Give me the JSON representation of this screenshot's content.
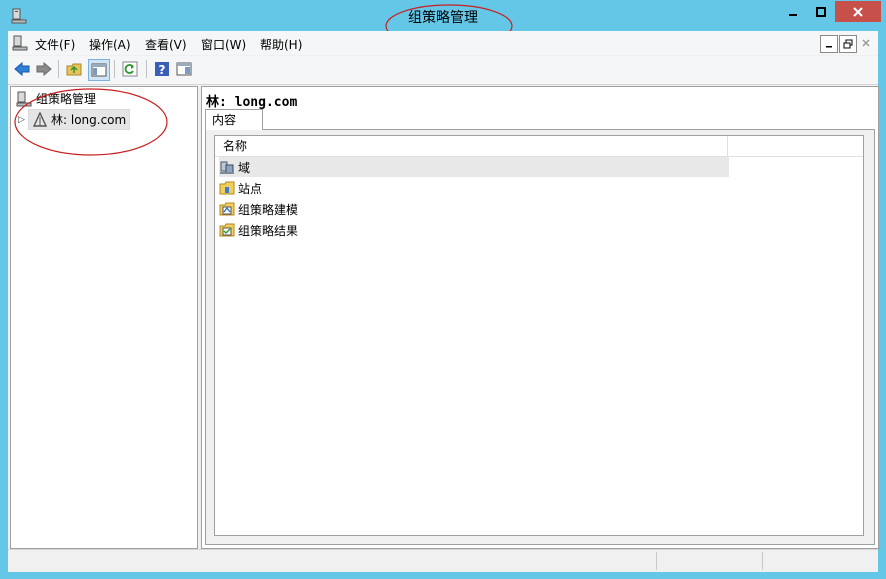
{
  "window": {
    "title": "组策略管理"
  },
  "menubar": {
    "items": [
      "文件(F)",
      "操作(A)",
      "查看(V)",
      "窗口(W)",
      "帮助(H)"
    ]
  },
  "tree": {
    "root_label": "组策略管理",
    "child_label": "林: long.com"
  },
  "right": {
    "title": "林: long.com",
    "tab_label": "内容",
    "column_header": "名称",
    "rows": [
      {
        "label": "域",
        "icon": "domain-icon"
      },
      {
        "label": "站点",
        "icon": "sites-folder-icon"
      },
      {
        "label": "组策略建模",
        "icon": "gp-modeling-icon"
      },
      {
        "label": "组策略结果",
        "icon": "gp-results-icon"
      }
    ]
  },
  "colors": {
    "titlebar": "#64c7e8",
    "close_button": "#c7504b",
    "annotation_ring": "#c81e1e"
  }
}
